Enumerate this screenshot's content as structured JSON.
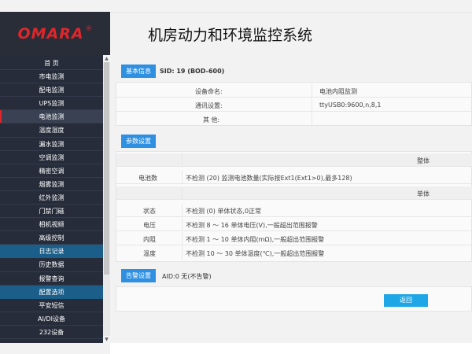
{
  "header": {
    "logo_text": "OMARA",
    "logo_reg": "®",
    "title": "机房动力和环境监控系统"
  },
  "sidebar": {
    "items": [
      {
        "label": "首 页",
        "type": "normal"
      },
      {
        "label": "市电监测",
        "type": "normal"
      },
      {
        "label": "配电监测",
        "type": "normal"
      },
      {
        "label": "UPS监测",
        "type": "normal"
      },
      {
        "label": "电池监测",
        "type": "active"
      },
      {
        "label": "温度湿度",
        "type": "normal"
      },
      {
        "label": "漏水监测",
        "type": "normal"
      },
      {
        "label": "空调监测",
        "type": "normal"
      },
      {
        "label": "精密空调",
        "type": "normal"
      },
      {
        "label": "烟雾监测",
        "type": "normal"
      },
      {
        "label": "红外监测",
        "type": "normal"
      },
      {
        "label": "门禁门磁",
        "type": "normal"
      },
      {
        "label": "相机视频",
        "type": "normal"
      },
      {
        "label": "高级控制",
        "type": "normal"
      },
      {
        "label": "日志记录",
        "type": "section"
      },
      {
        "label": "历史数据",
        "type": "normal"
      },
      {
        "label": "报警查询",
        "type": "normal"
      },
      {
        "label": "配置选项",
        "type": "section"
      },
      {
        "label": "平安短信",
        "type": "normal"
      },
      {
        "label": "AI/DI设备",
        "type": "normal"
      },
      {
        "label": "232设备",
        "type": "normal"
      }
    ],
    "scroll_up": "▲",
    "scroll_down": "▼"
  },
  "basic_info": {
    "tag": "基本信息",
    "sid_text": "SID: 19 (BOD-600)",
    "rows": [
      {
        "label": "设备命名:",
        "value": "电池内阻监测"
      },
      {
        "label": "通讯设置:",
        "value": "ttyUSB0:9600,n,8,1"
      },
      {
        "label": "其 他:",
        "value": ""
      }
    ]
  },
  "params": {
    "tag": "参数设置",
    "whole_header": "整体",
    "battery_count_label": "电池数",
    "battery_count_value": "不检测   (20) 监测电池数量(实际按Ext1(Ext1>0),最多128)",
    "single_header": "单体",
    "rows": [
      {
        "label": "状态",
        "value": "不检测   (0) 单体状态,0正常"
      },
      {
        "label": "电压",
        "value": "不检测     8  ～  16     单体电压(V),一般超出范围报警"
      },
      {
        "label": "内阻",
        "value": "不检测     1  ～  10     单体内阻(mΩ),一般超出范围报警"
      },
      {
        "label": "温度",
        "value": "不检测     10  ～  30     单体温度(℃),一般超出范围报警"
      }
    ]
  },
  "alarm": {
    "tag": "告警设置",
    "text": "AID:0 无(不告警)"
  },
  "actions": {
    "back_label": "返回"
  },
  "colors": {
    "brand_red": "#e0262a",
    "sidebar_bg": "#262c3a",
    "section_blue": "#1b5e89",
    "tag_blue": "#2f8fe0",
    "button_blue": "#1ea7e6"
  }
}
